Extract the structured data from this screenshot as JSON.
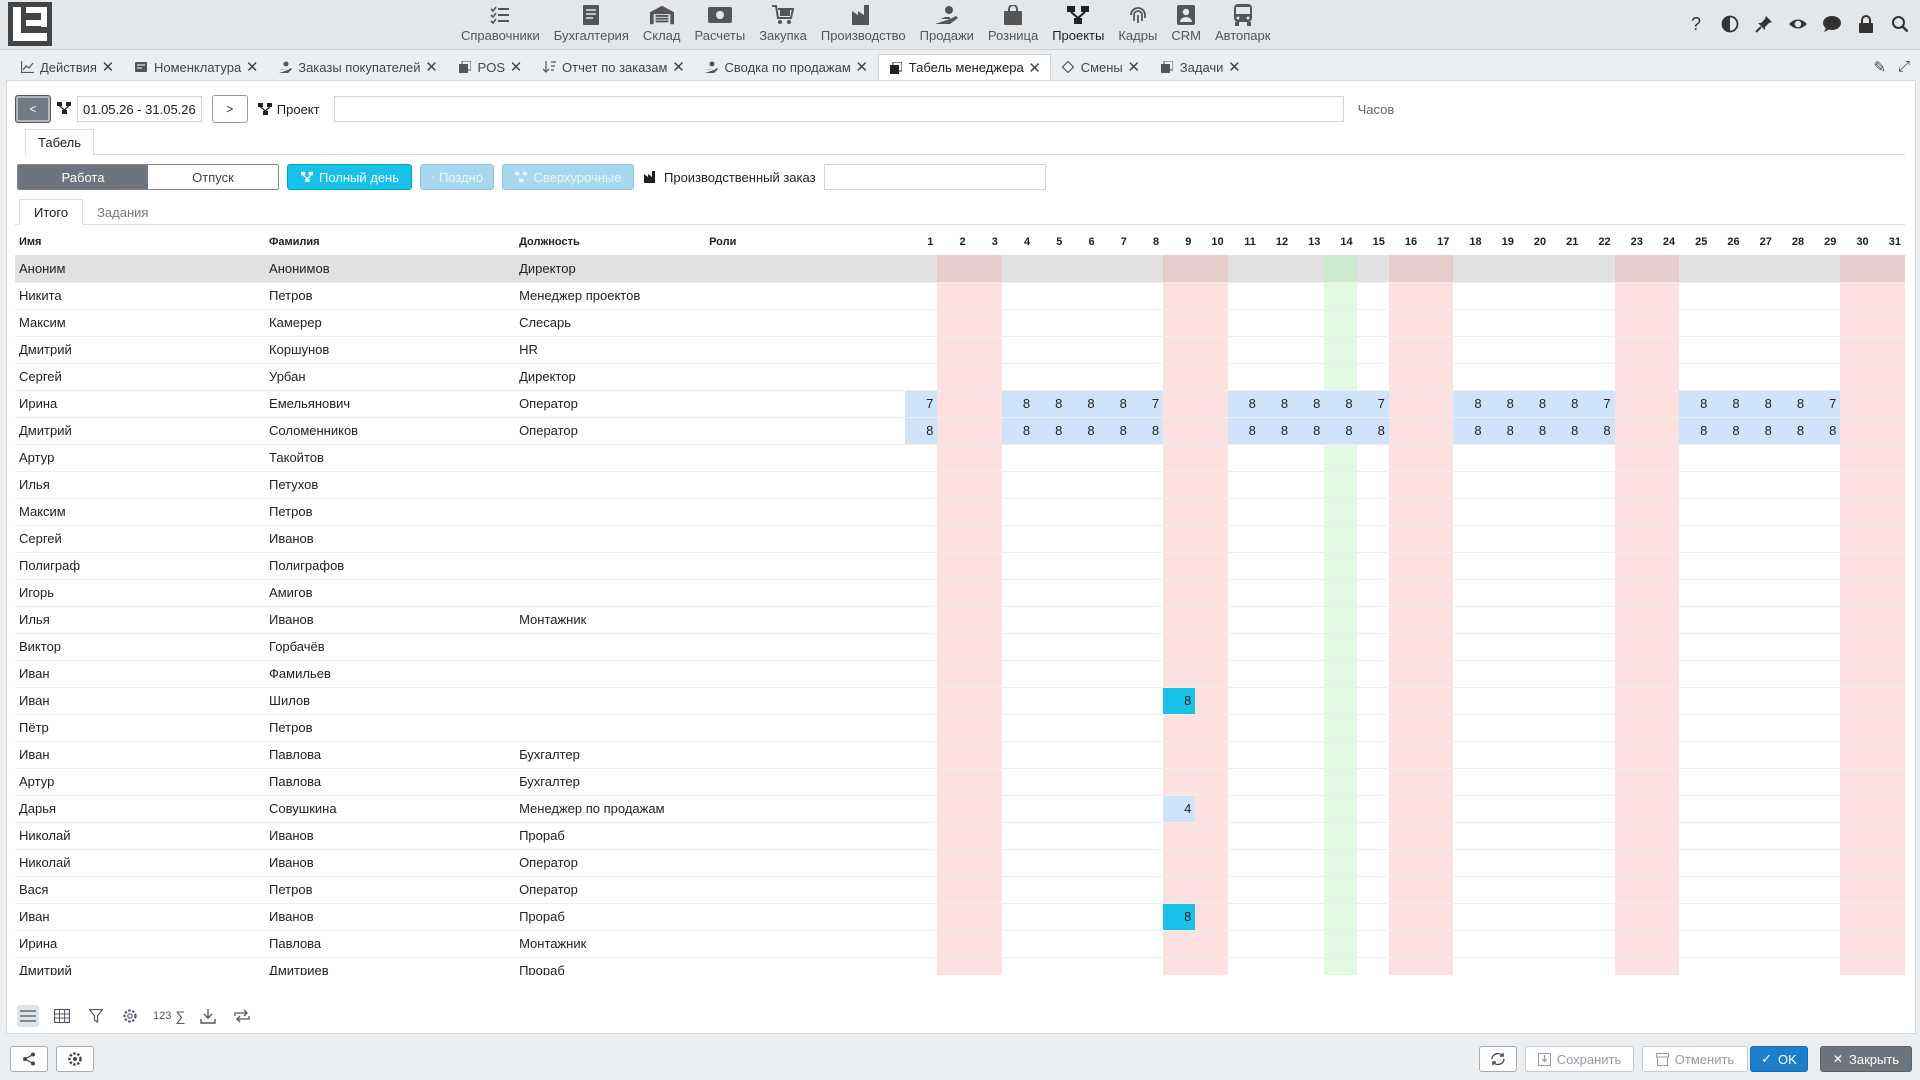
{
  "nav": {
    "items": [
      {
        "label": "Справочники",
        "icon": "list-icon"
      },
      {
        "label": "Бухгалтерия",
        "icon": "ledger-icon"
      },
      {
        "label": "Склад",
        "icon": "warehouse-icon"
      },
      {
        "label": "Расчеты",
        "icon": "money-icon"
      },
      {
        "label": "Закупка",
        "icon": "cart-icon"
      },
      {
        "label": "Производство",
        "icon": "factory-icon"
      },
      {
        "label": "Продажи",
        "icon": "hand-money-icon"
      },
      {
        "label": "Розница",
        "icon": "bag-icon"
      },
      {
        "label": "Проекты",
        "icon": "project-icon"
      },
      {
        "label": "Кадры",
        "icon": "fingerprint-icon"
      },
      {
        "label": "CRM",
        "icon": "badge-icon"
      },
      {
        "label": "Автопарк",
        "icon": "bus-icon"
      }
    ],
    "active": "Проекты"
  },
  "tabs": [
    {
      "label": "Действия",
      "icon": "chart-icon"
    },
    {
      "label": "Номенклатура",
      "icon": "catalog-icon"
    },
    {
      "label": "Заказы покупателей",
      "icon": "customer-order-icon"
    },
    {
      "label": "POS",
      "icon": "pos-icon"
    },
    {
      "label": "Отчет по заказам",
      "icon": "sort-icon"
    },
    {
      "label": "Сводка по продажам",
      "icon": "sales-icon"
    },
    {
      "label": "Табель менеджера",
      "icon": "copy-icon",
      "active": true
    },
    {
      "label": "Смены",
      "icon": "diamond-icon"
    },
    {
      "label": "Задачи",
      "icon": "tasks-icon"
    }
  ],
  "filter": {
    "prev": "<",
    "next": ">",
    "date_range": "01.05.26 - 31.05.26",
    "project_label": "Проект",
    "project_value": "",
    "hours_label": "Часов"
  },
  "subtab": "Табель",
  "modes": {
    "work": "Работа",
    "vacation": "Отпуск",
    "full_day": "Полный день",
    "late": "Поздно",
    "overtime": "Сверхурочные",
    "prod_order_label": "Производственный заказ",
    "prod_order_value": ""
  },
  "inner_tabs": [
    "Итого",
    "Задания"
  ],
  "columns": {
    "name": "Имя",
    "surname": "Фамилия",
    "position": "Должность",
    "roles": "Роли"
  },
  "days": [
    "1",
    "2",
    "3",
    "4",
    "5",
    "6",
    "7",
    "8",
    "9",
    "10",
    "11",
    "12",
    "13",
    "14",
    "15",
    "16",
    "17",
    "18",
    "19",
    "20",
    "21",
    "22",
    "23",
    "24",
    "25",
    "26",
    "27",
    "28",
    "29",
    "30",
    "31"
  ],
  "weekend_days": [
    2,
    3,
    9,
    10,
    16,
    17,
    23,
    24,
    30,
    31
  ],
  "holiday_days": [
    14
  ],
  "rows": [
    {
      "name": "Аноним",
      "surname": "Анонимов",
      "position": "Директор",
      "roles": "",
      "hours": {}
    },
    {
      "name": "Никита",
      "surname": "Петров",
      "position": "Менеджер проектов",
      "roles": "",
      "hours": {}
    },
    {
      "name": "Максим",
      "surname": "Камерер",
      "position": "Слесарь",
      "roles": "",
      "hours": {}
    },
    {
      "name": "Дмитрий",
      "surname": "Коршунов",
      "position": "HR",
      "roles": "",
      "hours": {}
    },
    {
      "name": "Сергей",
      "surname": "Урбан",
      "position": "Директор",
      "roles": "",
      "hours": {}
    },
    {
      "name": "Ирина",
      "surname": "Емельянович",
      "position": "Оператор",
      "roles": "",
      "hours": {
        "1": "7",
        "4": "8",
        "5": "8",
        "6": "8",
        "7": "8",
        "8": "7",
        "11": "8",
        "12": "8",
        "13": "8",
        "14": "8",
        "15": "7",
        "18": "8",
        "19": "8",
        "20": "8",
        "21": "8",
        "22": "7",
        "25": "8",
        "26": "8",
        "27": "8",
        "28": "8",
        "29": "7"
      }
    },
    {
      "name": "Дмитрий",
      "surname": "Соломенников",
      "position": "Оператор",
      "roles": "",
      "hours": {
        "1": "8",
        "4": "8",
        "5": "8",
        "6": "8",
        "7": "8",
        "8": "8",
        "11": "8",
        "12": "8",
        "13": "8",
        "14": "8",
        "15": "8",
        "18": "8",
        "19": "8",
        "20": "8",
        "21": "8",
        "22": "8",
        "25": "8",
        "26": "8",
        "27": "8",
        "28": "8",
        "29": "8"
      }
    },
    {
      "name": "Артур",
      "surname": "Такойтов",
      "position": "",
      "roles": "",
      "hours": {}
    },
    {
      "name": "Илья",
      "surname": "Петухов",
      "position": "",
      "roles": "",
      "hours": {}
    },
    {
      "name": "Максим",
      "surname": "Петров",
      "position": "",
      "roles": "",
      "hours": {}
    },
    {
      "name": "Сергей",
      "surname": "Иванов",
      "position": "",
      "roles": "",
      "hours": {}
    },
    {
      "name": "Полиграф",
      "surname": "Полиграфов",
      "position": "",
      "roles": "",
      "hours": {}
    },
    {
      "name": "Игорь",
      "surname": "Амигов",
      "position": "",
      "roles": "",
      "hours": {}
    },
    {
      "name": "Илья",
      "surname": "Иванов",
      "position": "Монтажник",
      "roles": "",
      "hours": {}
    },
    {
      "name": "Виктор",
      "surname": "Горбачёв",
      "position": "",
      "roles": "",
      "hours": {}
    },
    {
      "name": "Иван",
      "surname": "Фамильев",
      "position": "",
      "roles": "",
      "hours": {}
    },
    {
      "name": "Иван",
      "surname": "Шилов",
      "position": "",
      "roles": "",
      "hours": {
        "9": "8"
      },
      "full": [
        9
      ]
    },
    {
      "name": "Пётр",
      "surname": "Петров",
      "position": "",
      "roles": "",
      "hours": {}
    },
    {
      "name": "Иван",
      "surname": "Павлова",
      "position": "Бухгалтер",
      "roles": "",
      "hours": {}
    },
    {
      "name": "Артур",
      "surname": "Павлова",
      "position": "Бухгалтер",
      "roles": "",
      "hours": {}
    },
    {
      "name": "Дарья",
      "surname": "Совушкина",
      "position": "Менеджер по продажам",
      "roles": "",
      "hours": {
        "9": "4"
      }
    },
    {
      "name": "Николай",
      "surname": "Иванов",
      "position": "Прораб",
      "roles": "",
      "hours": {}
    },
    {
      "name": "Николай",
      "surname": "Иванов",
      "position": "Оператор",
      "roles": "",
      "hours": {}
    },
    {
      "name": "Вася",
      "surname": "Петров",
      "position": "Оператор",
      "roles": "",
      "hours": {}
    },
    {
      "name": "Иван",
      "surname": "Иванов",
      "position": "Прораб",
      "roles": "",
      "hours": {
        "9": "8"
      },
      "full": [
        9
      ]
    },
    {
      "name": "Ирина",
      "surname": "Павлова",
      "position": "Монтажник",
      "roles": "",
      "hours": {}
    },
    {
      "name": "Дмитрий",
      "surname": "Дмитриев",
      "position": "Прораб",
      "roles": "",
      "hours": {}
    }
  ],
  "bottom_tools": {
    "num_label": "123"
  },
  "footer": {
    "save": "Сохранить",
    "cancel": "Отменить",
    "ok": "OK",
    "close": "Закрыть"
  },
  "colors": {
    "weekend": "#fde0e0",
    "holiday": "#e1f9e1",
    "worked": "#cfe4fb",
    "full_day": "#17c1e8",
    "ok_button": "#1e7ec9"
  }
}
